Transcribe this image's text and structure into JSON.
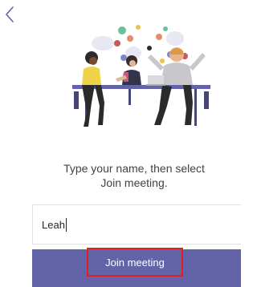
{
  "nav": {
    "back_icon": "chevron-left-icon"
  },
  "illustration": {
    "name": "meeting-people-illustration",
    "accent_color": "#6264a7"
  },
  "instruction": {
    "line1": "Type your name, then select",
    "line2": "Join meeting."
  },
  "name_field": {
    "value": "Leah"
  },
  "join": {
    "label": "Join meeting",
    "bar_color": "#6264a7",
    "highlight_color": "#e0201b"
  }
}
